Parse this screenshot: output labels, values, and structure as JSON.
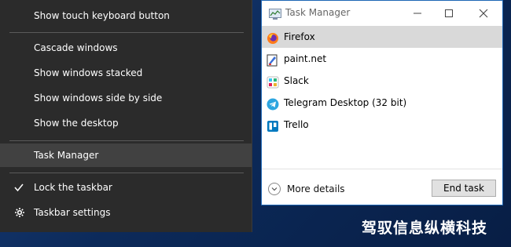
{
  "context_menu": {
    "items": [
      {
        "label": "Show touch keyboard button"
      },
      {
        "label": "Cascade windows"
      },
      {
        "label": "Show windows stacked"
      },
      {
        "label": "Show windows side by side"
      },
      {
        "label": "Show the desktop"
      },
      {
        "label": "Task Manager",
        "highlighted": true
      },
      {
        "label": "Lock the taskbar",
        "checked": true
      },
      {
        "label": "Taskbar settings",
        "icon": "gear-icon"
      }
    ]
  },
  "task_manager": {
    "title": "Task Manager",
    "apps": [
      {
        "name": "Firefox",
        "icon": "firefox-icon",
        "selected": true
      },
      {
        "name": "paint.net",
        "icon": "paintnet-icon"
      },
      {
        "name": "Slack",
        "icon": "slack-icon"
      },
      {
        "name": "Telegram Desktop (32 bit)",
        "icon": "telegram-icon"
      },
      {
        "name": "Trello",
        "icon": "trello-icon"
      }
    ],
    "more_details": "More details",
    "end_task": "End task",
    "colors": {
      "border": "#1d66b5",
      "selection": "#d9d9d9"
    }
  },
  "watermark": "驾驭信息纵横科技"
}
